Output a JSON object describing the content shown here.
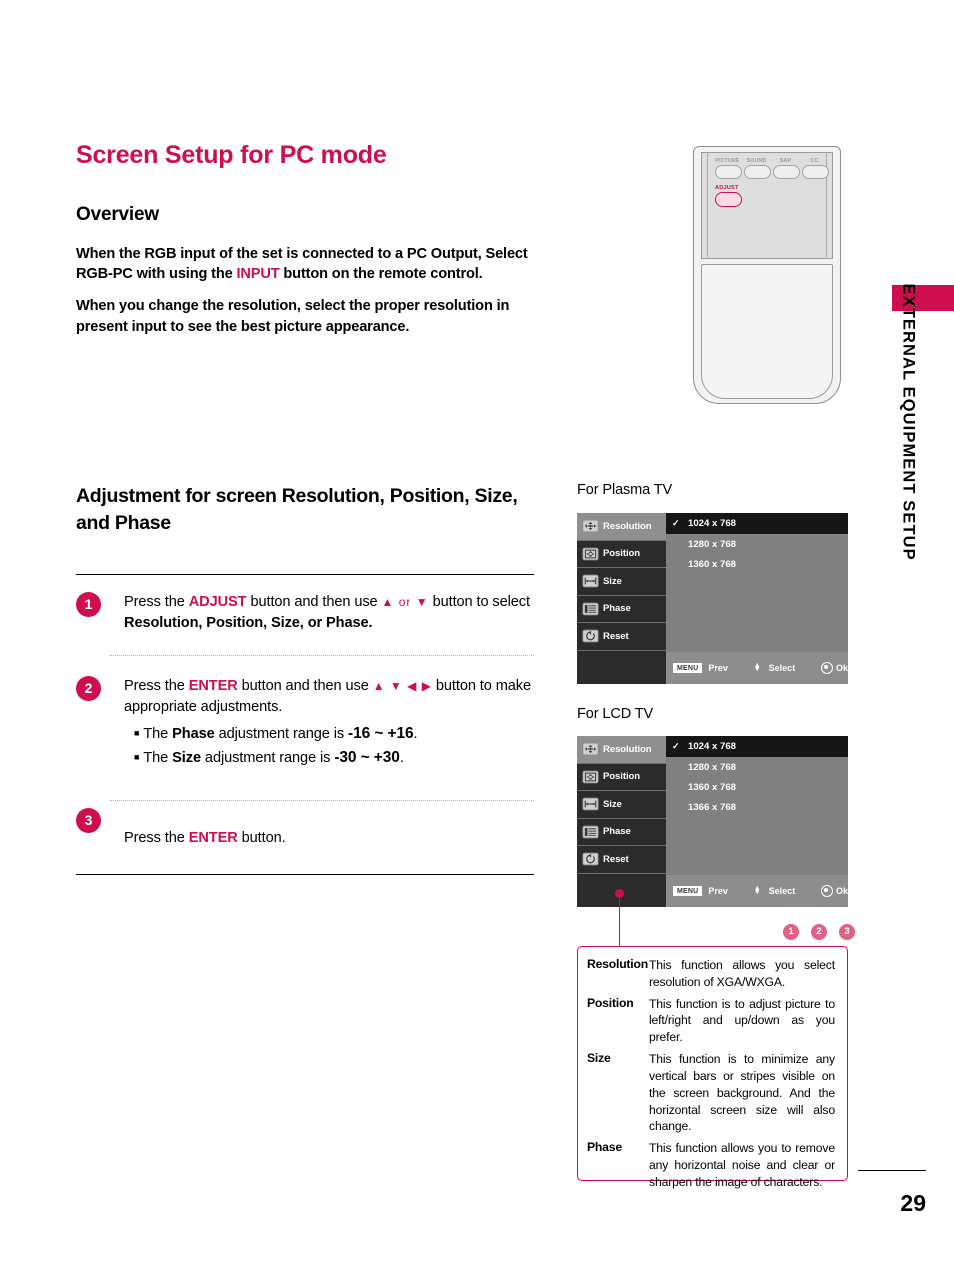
{
  "document": {
    "title": "Screen Setup for PC mode",
    "page_number": "29",
    "side_tab_label": "EXTERNAL EQUIPMENT SETUP"
  },
  "overview": {
    "heading": "Overview",
    "paragraph1_part1": "When the RGB input of the set is connected to a PC Output, Select RGB-PC with using the ",
    "paragraph1_accent": "INPUT",
    "paragraph1_part2": " button on the remote control.",
    "paragraph2": "When you change the resolution, select the proper resolution in present input to see the best picture appearance."
  },
  "adjustment": {
    "heading": "Adjustment for screen Resolution, Position, Size, and Phase",
    "steps": [
      {
        "number": "1",
        "text_part1": "Press the ",
        "accent1": "ADJUST",
        "text_part2": " button and then use ",
        "arrows": "▲ or ▼",
        "text_part3": " button to select ",
        "bold_items": "Resolution, Position, Size, or Phase."
      },
      {
        "number": "2",
        "text_part1": "Press the ",
        "accent1": "ENTER",
        "text_part2": " button and then use ",
        "arrows": "▲ ▼ ◀ ▶",
        "text_part3": " button to make appropriate adjustments.",
        "bullets": [
          {
            "pre": "The ",
            "term": "Phase",
            "mid": " adjustment range is ",
            "range": "-16 ~ +16",
            "post": "."
          },
          {
            "pre": "The ",
            "term": "Size",
            "mid": " adjustment range is ",
            "range": "-30 ~ +30",
            "post": "."
          }
        ]
      },
      {
        "number": "3",
        "text_part1": "Press the ",
        "accent1": "ENTER",
        "text_part2": " button."
      }
    ]
  },
  "remote": {
    "buttons": [
      {
        "label": "PICTURE",
        "name": "picture-button"
      },
      {
        "label": "SOUND",
        "name": "sound-button"
      },
      {
        "label": "SAP",
        "name": "sap-button"
      },
      {
        "label": "CC",
        "name": "cc-button"
      }
    ],
    "highlight_button": "ADJUST"
  },
  "osd": {
    "menu_items": [
      {
        "label": "Resolution",
        "icon": "four-way-arrow-icon"
      },
      {
        "label": "Position",
        "icon": "position-frame-icon"
      },
      {
        "label": "Size",
        "icon": "horizontal-arrow-icon"
      },
      {
        "label": "Phase",
        "icon": "phase-bars-icon"
      },
      {
        "label": "Reset",
        "icon": "reset-circle-icon"
      }
    ],
    "footer": {
      "menu_key": "MENU",
      "prev_label": "Prev",
      "select_label": "Select",
      "ok_label": "Ok"
    },
    "plasma": {
      "caption": "For Plasma TV",
      "options": [
        "1024 x 768",
        "1280 x 768",
        "1360 x 768"
      ],
      "checked": "1024 x 768",
      "check_glyph": "✓"
    },
    "lcd": {
      "caption": "For LCD TV",
      "options": [
        "1024 x 768",
        "1280 x 768",
        "1360 x 768",
        "1366 x 768"
      ],
      "checked": "1024 x 768",
      "check_glyph": "✓"
    }
  },
  "markers": [
    "1",
    "2",
    "3"
  ],
  "descriptions": [
    {
      "term": "Resolution",
      "text": "This function allows you select resolution of XGA/WXGA."
    },
    {
      "term": "Position",
      "text": "This function is to adjust picture to left/right and up/down as you prefer."
    },
    {
      "term": "Size",
      "text": "This function is to minimize any vertical bars or stripes visible on the screen background. And the horizontal screen size will also change."
    },
    {
      "term": "Phase",
      "text": "This function allows you to remove any horizontal noise and clear or sharpen the image of characters."
    }
  ],
  "colors": {
    "accent": "#ce0e4e",
    "marker": "#e06285",
    "osd_dark": "#2b2b2b",
    "osd_gray": "#808080"
  }
}
